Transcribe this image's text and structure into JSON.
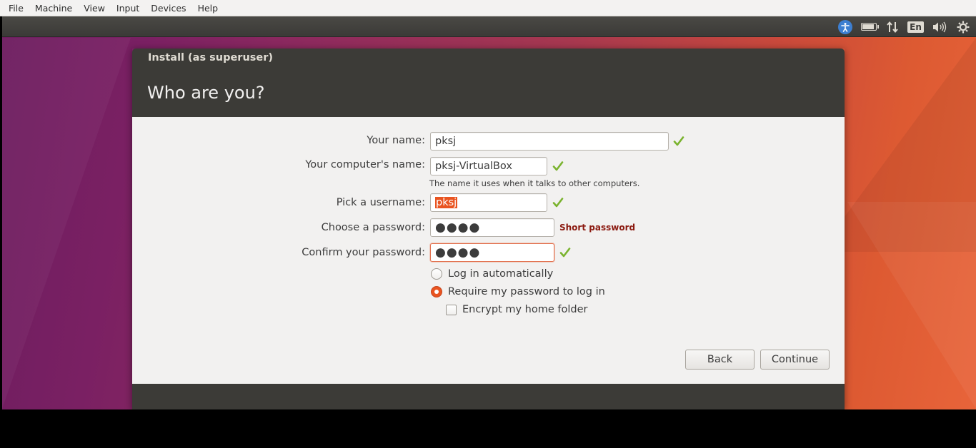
{
  "host_menu": [
    "File",
    "Machine",
    "View",
    "Input",
    "Devices",
    "Help"
  ],
  "panel": {
    "language": "En",
    "icons": [
      "accessibility-icon",
      "battery-icon",
      "network-icon",
      "keyboard-language-icon",
      "volume-icon",
      "system-gear-icon"
    ]
  },
  "window": {
    "title": "Install (as superuser)",
    "heading": "Who are you?"
  },
  "form": {
    "name_label": "Your name:",
    "name_value": "pksj",
    "computer_label": "Your computer's name:",
    "computer_value": "pksj-VirtualBox",
    "computer_hint": "The name it uses when it talks to other computers.",
    "username_label": "Pick a username:",
    "username_value": "pksj",
    "password_label": "Choose a password:",
    "password_value": "●●●●",
    "password_strength": "Short password",
    "confirm_label": "Confirm your password:",
    "confirm_value": "●●●●",
    "login_auto_label": "Log in automatically",
    "login_password_label": "Require my password to log in",
    "encrypt_label": "Encrypt my home folder",
    "selected_login_option": "Require my password to log in",
    "encrypt_checked": false
  },
  "buttons": {
    "back": "Back",
    "continue": "Continue"
  },
  "colors": {
    "accent": "#e95420",
    "valid_check": "#7ab32e",
    "warning_text": "#8b1a10"
  }
}
